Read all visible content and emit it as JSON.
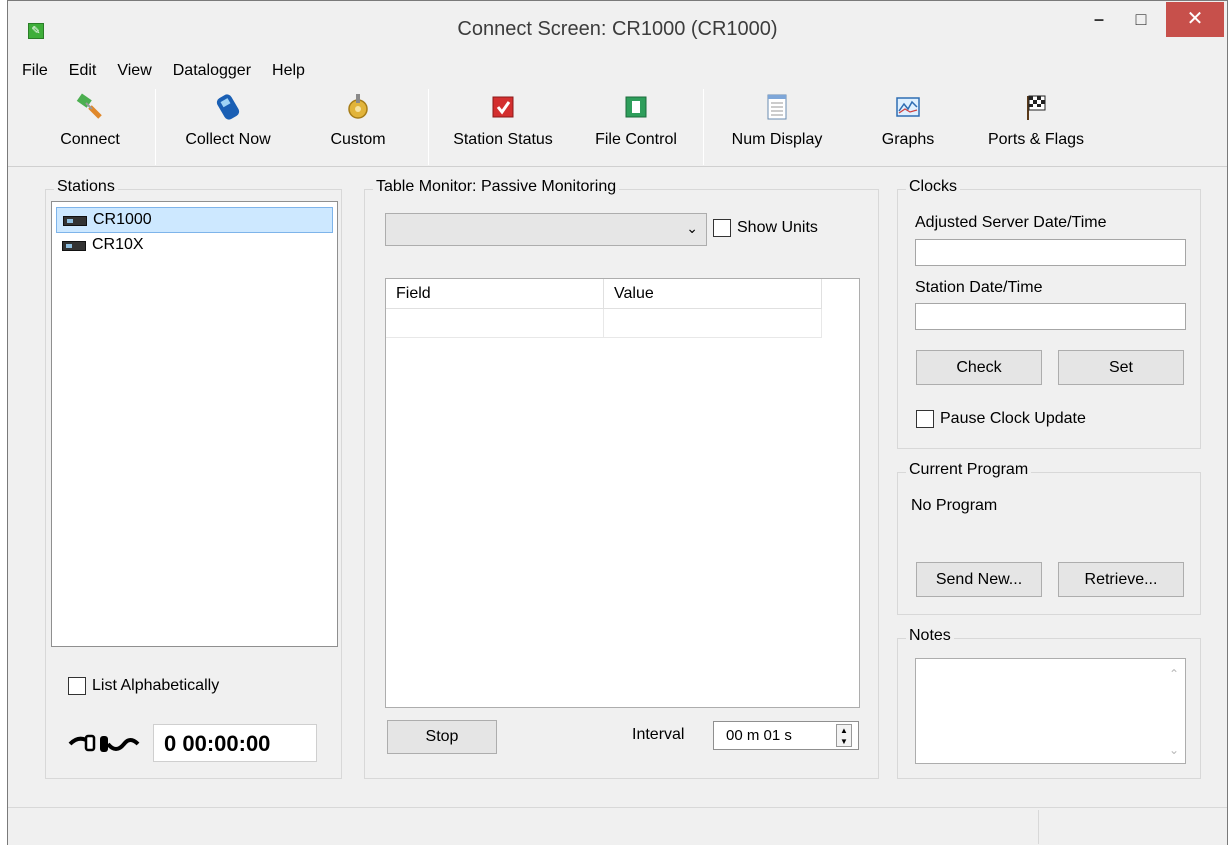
{
  "window": {
    "title": "Connect Screen: CR1000 (CR1000)",
    "minimize": "–",
    "maximize": "□",
    "close": "✕"
  },
  "menu": [
    "File",
    "Edit",
    "View",
    "Datalogger",
    "Help"
  ],
  "toolbar": {
    "connect": "Connect",
    "collect_now": "Collect Now",
    "custom": "Custom",
    "station_status": "Station Status",
    "file_control": "File Control",
    "num_display": "Num Display",
    "graphs": "Graphs",
    "ports_flags": "Ports & Flags"
  },
  "stations": {
    "title": "Stations",
    "items": [
      "CR1000",
      "CR10X"
    ],
    "selected": "CR1000",
    "list_alphabetically": "List Alphabetically",
    "timer": "0 00:00:00"
  },
  "table_monitor": {
    "title": "Table Monitor: Passive Monitoring",
    "show_units": "Show Units",
    "columns": [
      "Field",
      "Value"
    ],
    "stop": "Stop",
    "interval_label": "Interval",
    "interval_value": "00 m 01 s"
  },
  "clocks": {
    "title": "Clocks",
    "adjusted_label": "Adjusted Server Date/Time",
    "station_label": "Station Date/Time",
    "check": "Check",
    "set": "Set",
    "pause": "Pause Clock Update"
  },
  "program": {
    "title": "Current Program",
    "value": "No Program",
    "send_new": "Send New...",
    "retrieve": "Retrieve..."
  },
  "notes": {
    "title": "Notes"
  },
  "colors": {
    "accent_close": "#c7504b",
    "selection": "#cde8ff"
  }
}
